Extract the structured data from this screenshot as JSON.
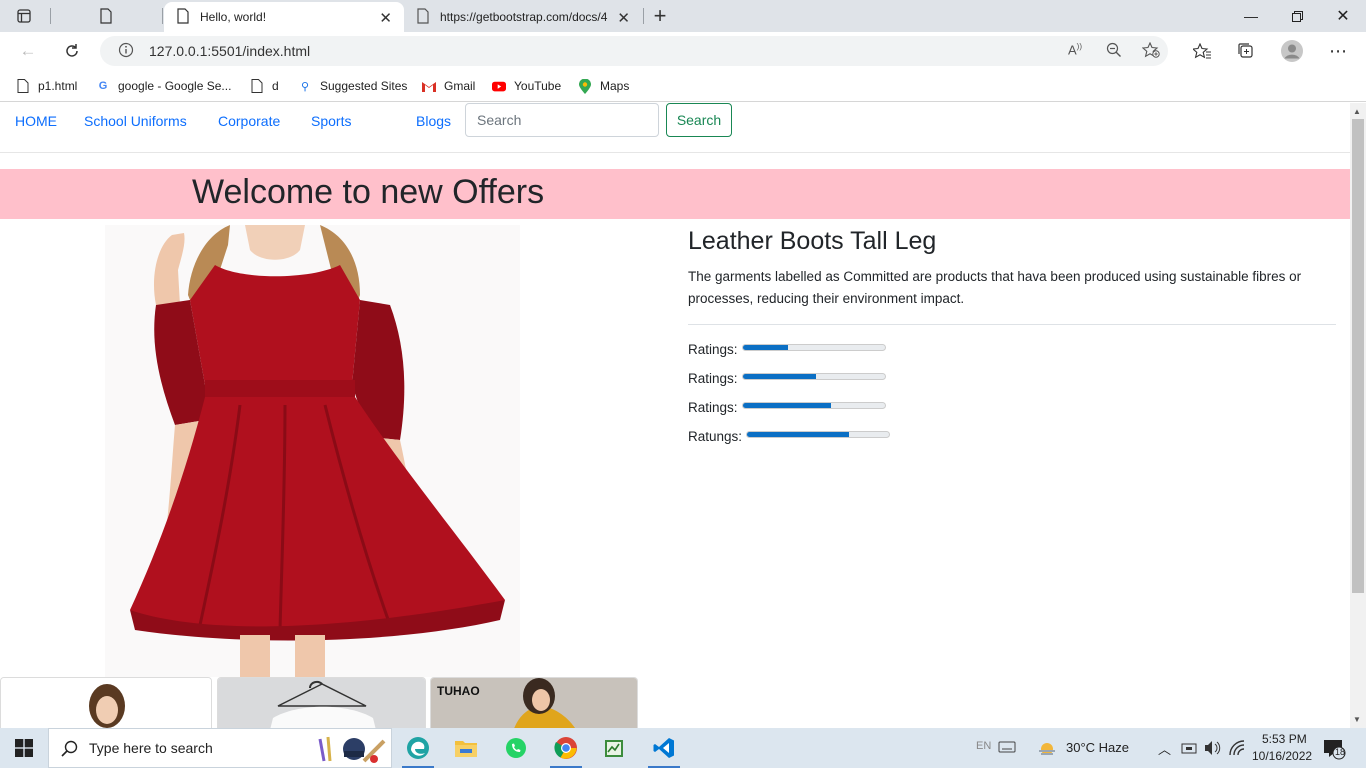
{
  "browser": {
    "tabs": [
      {
        "title": "Hello, world!",
        "active": true
      },
      {
        "title": "https://getbootstrap.com/docs/4",
        "active": false
      }
    ],
    "address": "127.0.0.1:5501/index.html",
    "favorites": [
      "p1.html",
      "google - Google Se...",
      "d",
      "Suggested Sites",
      "Gmail",
      "YouTube",
      "Maps"
    ]
  },
  "page": {
    "nav": {
      "links": [
        "HOME",
        "School Uniforms",
        "Corporate",
        "Sports",
        "Blogs"
      ],
      "search_placeholder": "Search",
      "search_button": "Search"
    },
    "banner_title": "Welcome to new Offers",
    "product": {
      "title": "Leather Boots Tall Leg",
      "description": "The garments labelled as Committed are products that hava been produced using sustainable fibres or processes, reducing their environment impact.",
      "ratings": [
        {
          "label": "Ratings:",
          "percent": 32
        },
        {
          "label": "Ratings:",
          "percent": 52
        },
        {
          "label": "Ratings:",
          "percent": 62
        },
        {
          "label": "Ratungs:",
          "percent": 72
        }
      ]
    },
    "thumb_caption": "TUHAO"
  },
  "taskbar": {
    "search_placeholder": "Type here to search",
    "weather": "30°C  Haze",
    "time": "5:53 PM",
    "date": "10/16/2022",
    "lang": "EN",
    "notifications": "18"
  },
  "colors": {
    "link": "#0d6efd",
    "banner": "#ffc0cb",
    "success": "#198754",
    "progress": "#0b6fc4",
    "dress": "#b0101e"
  }
}
